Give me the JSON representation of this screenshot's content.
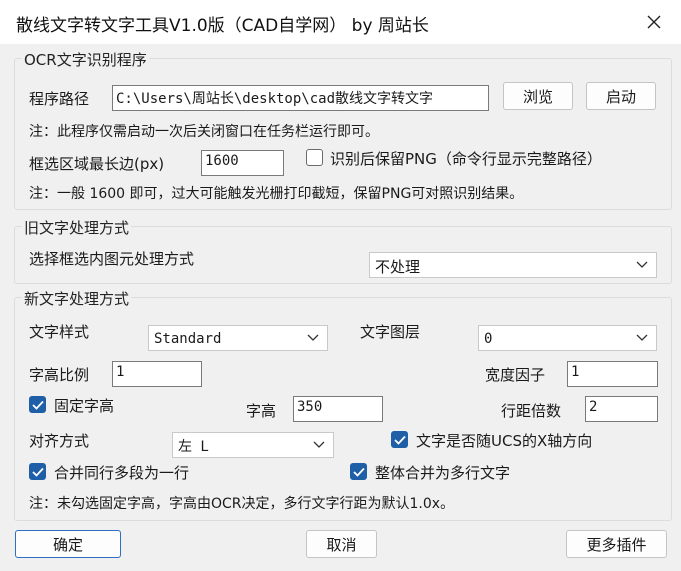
{
  "window": {
    "title": "散线文字转文字工具V1.0版（CAD自学网） by 周站长"
  },
  "ocr": {
    "group_title": "OCR文字识别程序",
    "path_label": "程序路径",
    "path_value": "C:\\Users\\周站长\\desktop\\cad散线文字转文字",
    "browse_label": "浏览",
    "start_label": "启动",
    "note1": "注：此程序仅需启动一次后关闭窗口在任务栏运行即可。",
    "maxedge_label": "框选区域最长边(px)",
    "maxedge_value": "1600",
    "keep_png_label": "识别后保留PNG（命令行显示完整路径）",
    "keep_png_checked": false,
    "note2": "注：一般 1600 即可，过大可能触发光栅打印截短，保留PNG可对照识别结果。"
  },
  "old_text": {
    "group_title": "旧文字处理方式",
    "mode_label": "选择框选内图元处理方式",
    "mode_value": "不处理"
  },
  "new_text": {
    "group_title": "新文字处理方式",
    "style_label": "文字样式",
    "style_value": "Standard",
    "layer_label": "文字图层",
    "layer_value": "0",
    "height_ratio_label": "字高比例",
    "height_ratio_value": "1",
    "width_factor_label": "宽度因子",
    "width_factor_value": "1",
    "fixed_height_label": "固定字高",
    "fixed_height_checked": true,
    "height_label": "字高",
    "height_value": "350",
    "line_spacing_label": "行距倍数",
    "line_spacing_value": "2",
    "align_label": "对齐方式",
    "align_value": "左 L",
    "follow_ucs_label": "文字是否随UCS的X轴方向",
    "follow_ucs_checked": true,
    "merge_lines_label": "合并同行多段为一行",
    "merge_lines_checked": true,
    "merge_mtext_label": "整体合并为多行文字",
    "merge_mtext_checked": true,
    "note": "注：未勾选固定字高，字高由OCR决定，多行文字行距为默认1.0x。"
  },
  "buttons": {
    "ok": "确定",
    "cancel": "取消",
    "more": "更多插件"
  },
  "colors": {
    "accent": "#1f5fa8",
    "window_bg": "#f0f0f0"
  }
}
